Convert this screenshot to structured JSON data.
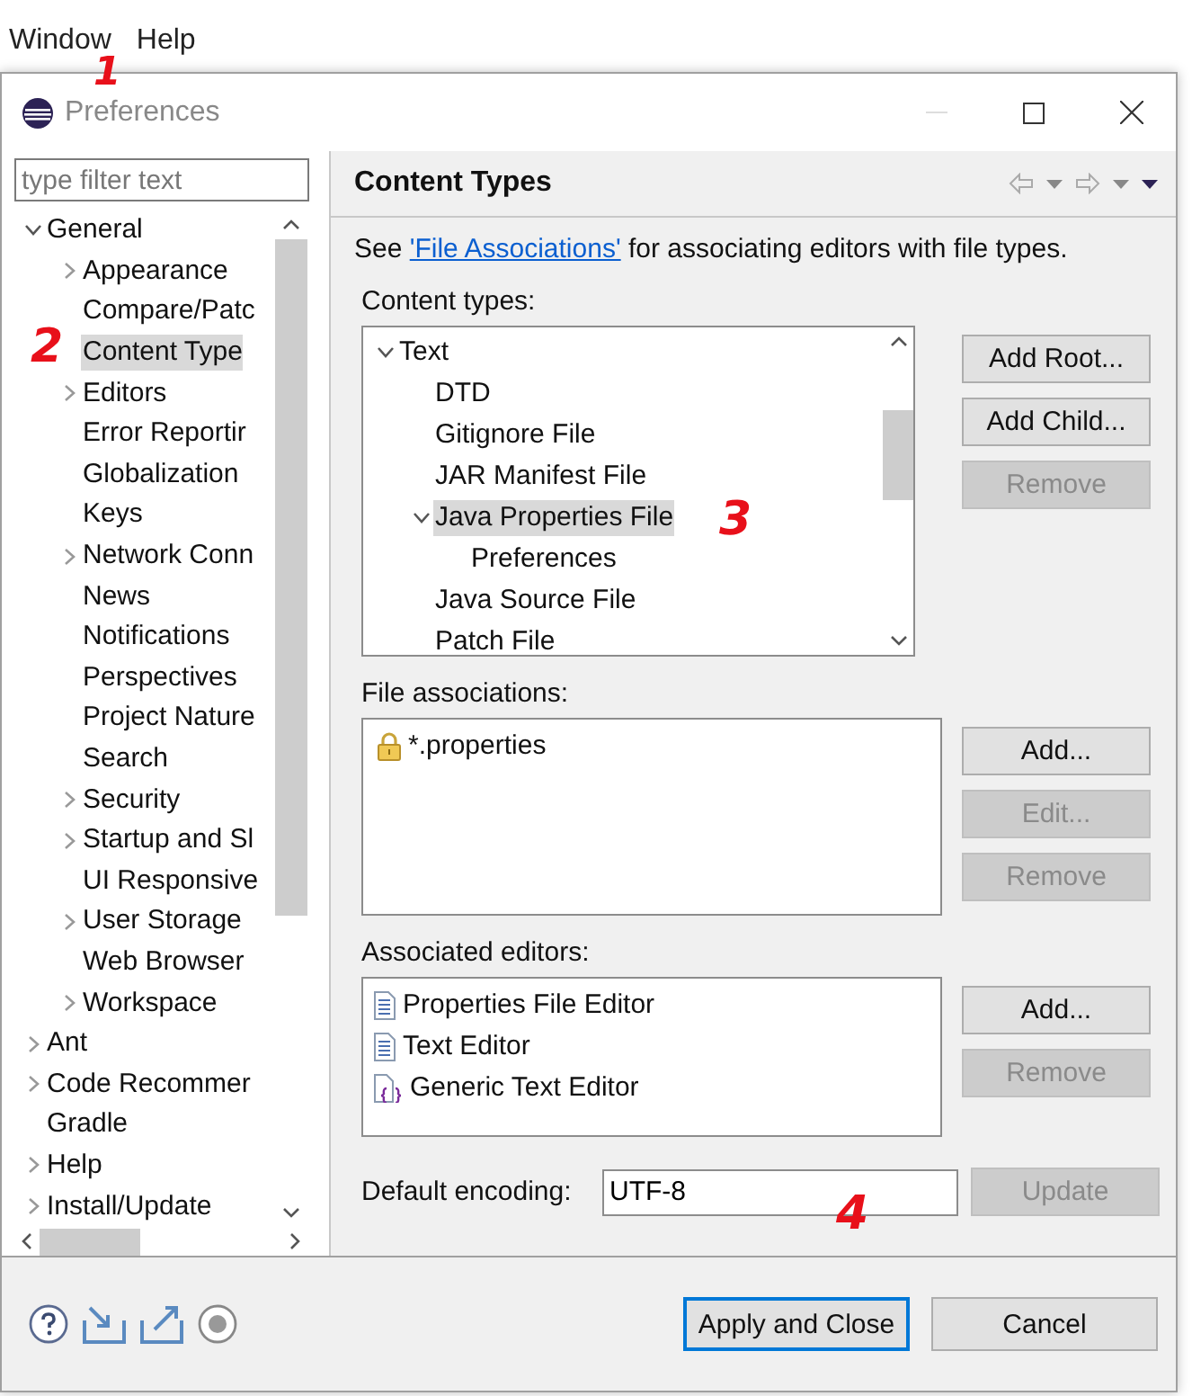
{
  "menu_bar": [
    {
      "label": "Window"
    },
    {
      "label": "Help"
    }
  ],
  "dialog": {
    "title": "Preferences",
    "filter": {
      "placeholder": "type filter text"
    },
    "tree": [
      {
        "label": "General",
        "expanded": true,
        "selected": false,
        "children": [
          {
            "label": "Appearance",
            "expanded": false,
            "selected": false
          },
          {
            "label": "Compare/Patc",
            "selected": false
          },
          {
            "label": "Content Type",
            "selected": true
          },
          {
            "label": "Editors",
            "expanded": false,
            "selected": false
          },
          {
            "label": "Error Reportir",
            "selected": false
          },
          {
            "label": "Globalization",
            "selected": false
          },
          {
            "label": "Keys",
            "selected": false
          },
          {
            "label": "Network Conn",
            "expanded": false,
            "selected": false
          },
          {
            "label": "News",
            "selected": false
          },
          {
            "label": "Notifications",
            "selected": false
          },
          {
            "label": "Perspectives",
            "selected": false
          },
          {
            "label": "Project Nature",
            "selected": false
          },
          {
            "label": "Search",
            "selected": false
          },
          {
            "label": "Security",
            "expanded": false,
            "selected": false
          },
          {
            "label": "Startup and Sl",
            "expanded": false,
            "selected": false
          },
          {
            "label": "UI Responsive",
            "selected": false
          },
          {
            "label": "User Storage",
            "expanded": false,
            "selected": false
          },
          {
            "label": "Web Browser",
            "selected": false
          },
          {
            "label": "Workspace",
            "expanded": false,
            "selected": false
          }
        ]
      },
      {
        "label": "Ant",
        "expanded": false,
        "selected": false
      },
      {
        "label": "Code Recommer",
        "expanded": false,
        "selected": false
      },
      {
        "label": "Gradle",
        "selected": false
      },
      {
        "label": "Help",
        "expanded": false,
        "selected": false
      },
      {
        "label": "Install/Update",
        "expanded": false,
        "selected": false
      }
    ],
    "page_title": "Content Types",
    "intro": {
      "before": "See ",
      "link": "'File Associations'",
      "after": " for associating editors with file types."
    },
    "content_types": {
      "label": "Content types:",
      "items": [
        {
          "label": "Text",
          "expanded": true,
          "selected": false,
          "children": [
            {
              "label": "DTD",
              "selected": false
            },
            {
              "label": "Gitignore File",
              "selected": false
            },
            {
              "label": "JAR Manifest File",
              "selected": false
            },
            {
              "label": "Java Properties File",
              "expanded": true,
              "selected": true,
              "children": [
                {
                  "label": "Preferences",
                  "selected": false
                }
              ]
            },
            {
              "label": "Java Source File",
              "selected": false
            },
            {
              "label": "Patch File",
              "selected": false
            }
          ]
        }
      ],
      "buttons": [
        {
          "label": "Add Root...",
          "disabled": false
        },
        {
          "label": "Add Child...",
          "disabled": false
        },
        {
          "label": "Remove",
          "disabled": true
        }
      ]
    },
    "file_associations": {
      "label": "File associations:",
      "items": [
        {
          "label": "*.properties",
          "locked": true
        }
      ],
      "buttons": [
        {
          "label": "Add...",
          "disabled": false
        },
        {
          "label": "Edit...",
          "disabled": true
        },
        {
          "label": "Remove",
          "disabled": true
        }
      ]
    },
    "associated_editors": {
      "label": "Associated editors:",
      "items": [
        {
          "label": "Properties File Editor",
          "kind": "text"
        },
        {
          "label": "Text Editor",
          "kind": "text"
        },
        {
          "label": "Generic Text Editor",
          "kind": "generic"
        }
      ],
      "buttons": [
        {
          "label": "Add...",
          "disabled": false
        },
        {
          "label": "Remove",
          "disabled": true
        }
      ]
    },
    "encoding": {
      "label": "Default encoding:",
      "value": "UTF-8",
      "button": {
        "label": "Update",
        "disabled": true
      }
    },
    "footer_buttons": [
      {
        "label": "Apply and Close",
        "default": true
      },
      {
        "label": "Cancel",
        "default": false
      }
    ]
  },
  "annotations": [
    {
      "text": "1"
    },
    {
      "text": "2"
    },
    {
      "text": "3"
    },
    {
      "text": "4"
    }
  ]
}
